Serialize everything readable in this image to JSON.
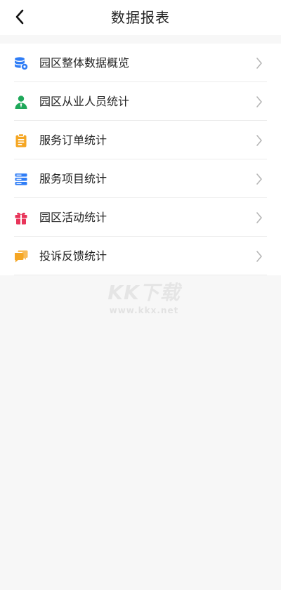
{
  "header": {
    "title": "数据报表",
    "back_icon": "chevron-left-icon"
  },
  "menu": {
    "items": [
      {
        "label": "园区整体数据概览",
        "icon": "database-gear-icon",
        "icon_color": "#2f7df6"
      },
      {
        "label": "园区从业人员统计",
        "icon": "person-icon",
        "icon_color": "#1fa85a"
      },
      {
        "label": "服务订单统计",
        "icon": "clipboard-icon",
        "icon_color": "#f5a623"
      },
      {
        "label": "服务项目统计",
        "icon": "server-list-icon",
        "icon_color": "#2f7df6"
      },
      {
        "label": "园区活动统计",
        "icon": "gift-icon",
        "icon_color": "#e8355a"
      },
      {
        "label": "投诉反馈统计",
        "icon": "chat-bubbles-icon",
        "icon_color": "#f5a623"
      }
    ],
    "chevron_icon": "chevron-right-icon"
  },
  "watermark": {
    "logo": "KK下载",
    "url": "www.kkx.net"
  },
  "colors": {
    "background": "#f7f7f7",
    "surface": "#ffffff",
    "text": "#222222",
    "divider": "#ececec"
  }
}
